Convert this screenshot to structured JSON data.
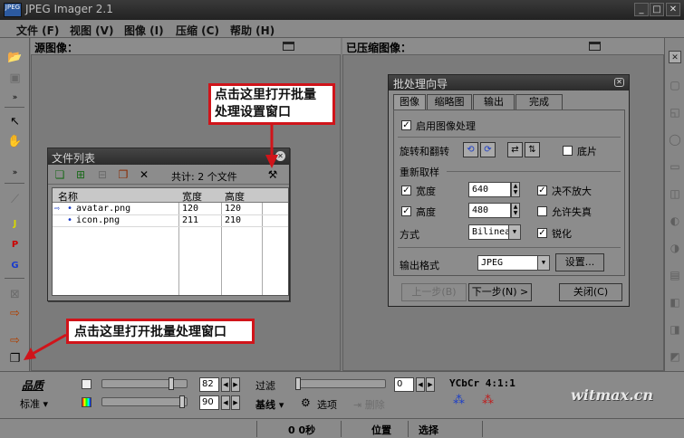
{
  "titlebar": {
    "icon_text": "JPEG",
    "title": "JPEG Imager 2.1"
  },
  "menu": [
    "文件 (F)",
    "视图 (V)",
    "图像 (I)",
    "压缩 (C)",
    "帮助 (H)"
  ],
  "panels": {
    "source_title": "源图像：",
    "compressed_title": "已压缩图像："
  },
  "filelist": {
    "title": "文件列表",
    "count_text": "共计: 2 个文件",
    "columns": [
      "名称",
      "宽度",
      "高度"
    ],
    "rows": [
      {
        "name": "avatar.png",
        "width": "120",
        "height": "120"
      },
      {
        "name": "icon.png",
        "width": "211",
        "height": "210"
      }
    ]
  },
  "dialog": {
    "title": "批处理向导",
    "tabs": [
      "图像",
      "缩略图",
      "输出",
      "完成"
    ],
    "enable_label": "启用图像处理",
    "rotate_label": "旋转和翻转",
    "bottom_label": "底片",
    "resample_label": "重新取样",
    "width_label": "宽度",
    "width_value": "640",
    "height_label": "高度",
    "height_value": "480",
    "no_enlarge_label": "决不放大",
    "allow_distort_label": "允许失真",
    "method_label": "方式",
    "method_value": "Bilinear",
    "sharpen_label": "锐化",
    "output_format_label": "输出格式",
    "output_format_value": "JPEG",
    "settings_button": "设置...",
    "prev_button": "上一步(B)",
    "next_button": "下一步(N) >",
    "close_button": "关闭(C)"
  },
  "callouts": {
    "top": "点击这里打开批量\n处理设置窗口",
    "bottom": "点击这里打开批量处理窗口"
  },
  "bottom": {
    "quality_label": "品质",
    "standard_label": "标准",
    "quality_value": "82",
    "smoothing_value": "90",
    "filter_label": "过滤",
    "filter_value": "0",
    "baseline_label": "基线",
    "options_label": "选项",
    "remove_label": "删除",
    "subsampling_label": "YCbCr 4:1:1"
  },
  "status": {
    "time": "0 0秒",
    "position": "位置",
    "selection": "选择"
  },
  "watermark": "witmax.cn",
  "colors": {
    "callout_border": "#d0141a",
    "arrow": "#d0141a"
  }
}
